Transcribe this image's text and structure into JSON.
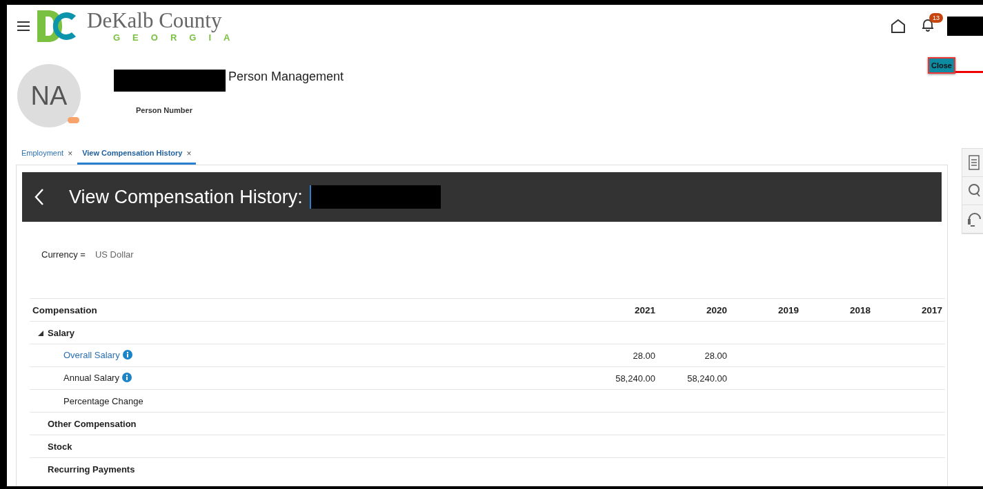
{
  "header": {
    "logo_title": "DeKalb County",
    "logo_subtitle": "GEORGIA",
    "notification_count": "13"
  },
  "person": {
    "initials": "NA",
    "title": "Person Management",
    "number_label": "Person Number"
  },
  "close_button": "Close",
  "tabs": [
    {
      "label": "Employment",
      "close": "×",
      "selected": false
    },
    {
      "label": "View Compensation History",
      "close": "×",
      "selected": true
    }
  ],
  "page_title": "View Compensation History:",
  "currency": {
    "label": "Currency =",
    "value": "US Dollar"
  },
  "table": {
    "columns": [
      "Compensation",
      "2021",
      "2020",
      "2019",
      "2018",
      "2017"
    ],
    "rows": [
      {
        "label": "Salary",
        "expanded": true,
        "children": [
          {
            "label": "Overall Salary",
            "kind": "link",
            "info": true,
            "values": [
              "28.00",
              "28.00"
            ]
          },
          {
            "label": "Annual Salary",
            "kind": "plain",
            "info": true,
            "values": [
              "58,240.00",
              "58,240.00"
            ]
          },
          {
            "label": "Percentage Change",
            "kind": "plain",
            "info": false
          }
        ]
      },
      {
        "label": "Other Compensation"
      },
      {
        "label": "Stock"
      },
      {
        "label": "Recurring Payments"
      }
    ]
  }
}
